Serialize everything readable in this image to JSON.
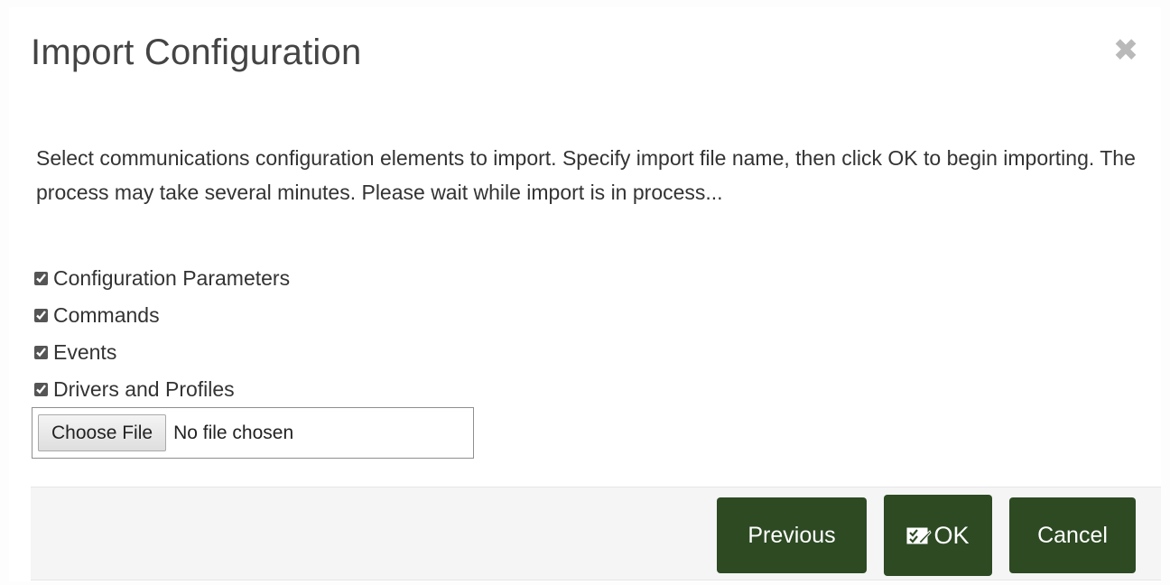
{
  "dialog": {
    "title": "Import Configuration",
    "close_icon": "close-icon",
    "description": "Select communications configuration elements to import. Specify import file name, then click OK to begin importing. The process may take several minutes. Please wait while import is in process...",
    "options": [
      {
        "label": "Configuration Parameters",
        "checked": true
      },
      {
        "label": "Commands",
        "checked": true
      },
      {
        "label": "Events",
        "checked": true
      },
      {
        "label": "Drivers and Profiles",
        "checked": true
      }
    ],
    "file_input": {
      "button_label": "Choose File",
      "status": "No file chosen"
    },
    "footer": {
      "previous_label": "Previous",
      "ok_label": "OK",
      "ok_icon": "checklist-icon",
      "cancel_label": "Cancel"
    }
  },
  "colors": {
    "button_bg": "#2d4a23",
    "title_text": "#444444",
    "close_icon": "#b9b9b9",
    "footer_bg": "#f5f5f5"
  }
}
